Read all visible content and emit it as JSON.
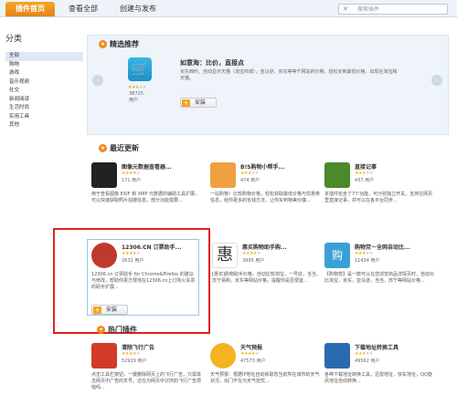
{
  "topbar": {
    "tabs": [
      {
        "label": "插件首页",
        "active": true
      },
      {
        "label": "查看全部",
        "active": false
      },
      {
        "label": "创建与发布",
        "active": false
      }
    ],
    "search_placeholder": "搜索插件"
  },
  "sidebar": {
    "title": "分类",
    "items": [
      {
        "label": "全部",
        "active": true
      },
      {
        "label": "购物"
      },
      {
        "label": "游戏"
      },
      {
        "label": "音乐视频"
      },
      {
        "label": "社交"
      },
      {
        "label": "新闻阅读"
      },
      {
        "label": "生活时尚"
      },
      {
        "label": "实用工具"
      },
      {
        "label": "其他"
      }
    ]
  },
  "featured": {
    "heading": "精选推荐",
    "name": "如意淘：比价，直接点",
    "desc": "买东西时，自动显示天猫（淘宝商城），亚马逊，京东等等千网站的价格，轻松买到最低价格，出现在淘宝和天猫。",
    "rating": 3,
    "users_count": "38725",
    "users_label": "用户",
    "install_label": "安装",
    "icon_name": "shopping-cart-icon"
  },
  "latest": {
    "heading": "最近更新",
    "cards": [
      {
        "name": "图像元数据查看器...",
        "rating": 4,
        "users": "171 用户",
        "desc": "用于查看图像 EXIF 和 XMP 元数据的辅助工具扩展，可以快速获取照片拍摄信息，部分功能需要...",
        "icon_color": "#222222",
        "icon_name": "camera-icon"
      },
      {
        "name": "B!S购物小帮手...",
        "rating": 3,
        "users": "474 用户",
        "desc": "一站购物！比较购物价格，轻松获取最低价格与优惠券信息，给你更多的省钱方法，让你买到物美价廉...",
        "icon_color": "#f0a040",
        "icon_name": "shopping-bag-icon"
      },
      {
        "name": "直接记事",
        "rating": 3,
        "users": "437 用户",
        "desc": "本插件包含了7个功能，可分别独立开关，支持在网页里直接记事，并可以在各平台同步...",
        "icon_color": "#4a8a2a",
        "icon_name": "note-icon"
      },
      {
        "name": "12306.CN 订票助手...",
        "rating": 4,
        "users": "2632 用户",
        "desc": "12306.cn 订票助手 for Chrome&Firefox 的建议与修改，帮助你更方便地在12306.cn上订购火车票的助手扩展...",
        "icon_color": "#c0392b",
        "icon_name": "train-ticket-icon"
      },
      {
        "name": "惠买购物助手购...",
        "rating": 4,
        "users": "3995 用户",
        "desc": "[惠买]购物助手价格，自动比较淘宝，一号店，当当，苏宁易购，京东等网站价格，提醒你是否便宜...",
        "icon_color": "#333333",
        "icon_name": "calligraphy-logo-icon"
      },
      {
        "name": "购物党－全网自动比...",
        "rating": 3,
        "users": "11434 用户",
        "desc": "【购物党】是一款可以在您浏览商品详情页时，自动对比淘宝，京东，亚马逊，当当，苏宁等网站价格...",
        "icon_color": "#3aa0d8",
        "icon_name": "gou-logo-icon"
      }
    ]
  },
  "highlight_install_label": "安装",
  "hot": {
    "heading": "热门插件",
    "cards": [
      {
        "name": "清除飞行广告",
        "rating": 4,
        "users": "52929 用户",
        "desc": "点击工具栏按钮，一键删除网页上的飞行广告，只需单击网页中广告的叉号，还在为网页中讨厌的飞行广告烦恼吗...",
        "icon_color": "#d23a2a",
        "icon_name": "plane-icon"
      },
      {
        "name": "天气预报",
        "rating": 4,
        "users": "47573 用户",
        "desc": "天气预报：根据IP地址自动获取您当前所在城市的天气状况，出门不在为天气担忧...",
        "icon_color": "#f5b324",
        "icon_name": "sun-icon"
      },
      {
        "name": "下载地址转换工具",
        "rating": 3,
        "users": "49562 用户",
        "desc": "各种下载地址转换工具，迅雷地址，快车地址，QQ旋风地址自动转换...",
        "icon_color": "#2a6ab0",
        "icon_name": "download-arrow-icon"
      }
    ]
  }
}
